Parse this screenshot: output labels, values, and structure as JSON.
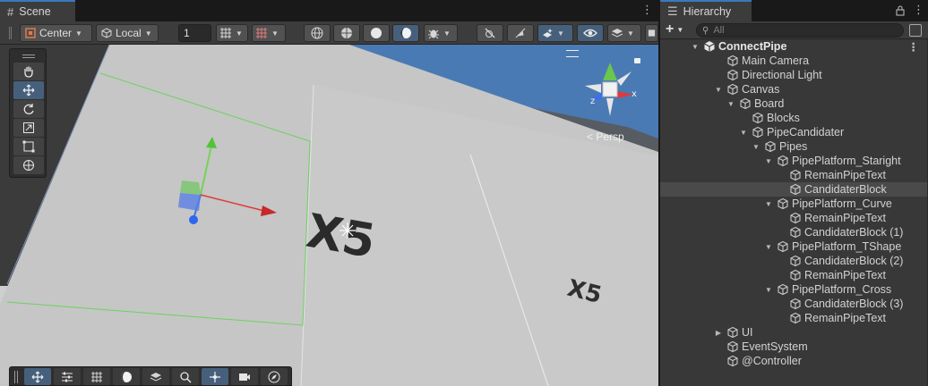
{
  "scene": {
    "tab_label": "Scene",
    "pivot_label": "Center",
    "space_label": "Local",
    "grid_value": "1",
    "persp_label": "Persp",
    "viewport_text": [
      "X5",
      "X5"
    ],
    "gizmo_axis_labels": {
      "x": "x",
      "z": "z"
    }
  },
  "hierarchy": {
    "tab_label": "Hierarchy",
    "search_placeholder": "All",
    "rows": [
      {
        "label": "ConnectPipe",
        "depth": 0,
        "fold": "down",
        "root": true
      },
      {
        "label": "Main Camera",
        "depth": 1,
        "fold": "none"
      },
      {
        "label": "Directional Light",
        "depth": 1,
        "fold": "none"
      },
      {
        "label": "Canvas",
        "depth": 1,
        "fold": "down"
      },
      {
        "label": "Board",
        "depth": 2,
        "fold": "down"
      },
      {
        "label": "Blocks",
        "depth": 3,
        "fold": "none"
      },
      {
        "label": "PipeCandidater",
        "depth": 3,
        "fold": "down"
      },
      {
        "label": "Pipes",
        "depth": 4,
        "fold": "down"
      },
      {
        "label": "PipePlatform_Staright",
        "depth": 5,
        "fold": "down"
      },
      {
        "label": "RemainPipeText",
        "depth": 6,
        "fold": "none"
      },
      {
        "label": "CandidaterBlock",
        "depth": 6,
        "fold": "none",
        "selected": true
      },
      {
        "label": "PipePlatform_Curve",
        "depth": 5,
        "fold": "down"
      },
      {
        "label": "RemainPipeText",
        "depth": 6,
        "fold": "none"
      },
      {
        "label": "CandidaterBlock (1)",
        "depth": 6,
        "fold": "none"
      },
      {
        "label": "PipePlatform_TShape",
        "depth": 5,
        "fold": "down"
      },
      {
        "label": "CandidaterBlock (2)",
        "depth": 6,
        "fold": "none"
      },
      {
        "label": "RemainPipeText",
        "depth": 6,
        "fold": "none"
      },
      {
        "label": "PipePlatform_Cross",
        "depth": 5,
        "fold": "down"
      },
      {
        "label": "CandidaterBlock (3)",
        "depth": 6,
        "fold": "none"
      },
      {
        "label": "RemainPipeText",
        "depth": 6,
        "fold": "none"
      },
      {
        "label": "UI",
        "depth": 1,
        "fold": "right"
      },
      {
        "label": "EventSystem",
        "depth": 1,
        "fold": "none"
      },
      {
        "label": "@Controller",
        "depth": 1,
        "fold": "none"
      }
    ]
  },
  "colors": {
    "accent_blue": "#46607c",
    "tab_highlight": "#3a79bb",
    "selection_row": "#4a4a4a",
    "axis_x": "#e0393a",
    "axis_y": "#52c23a",
    "axis_z": "#3e6fe8"
  }
}
